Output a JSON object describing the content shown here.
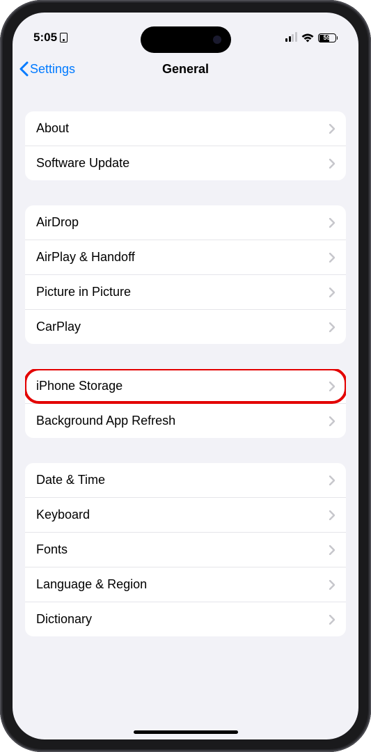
{
  "status": {
    "time": "5:05",
    "battery": "59"
  },
  "nav": {
    "back": "Settings",
    "title": "General"
  },
  "groups": [
    {
      "items": [
        {
          "label": "About"
        },
        {
          "label": "Software Update"
        }
      ]
    },
    {
      "items": [
        {
          "label": "AirDrop"
        },
        {
          "label": "AirPlay & Handoff"
        },
        {
          "label": "Picture in Picture"
        },
        {
          "label": "CarPlay"
        }
      ]
    },
    {
      "items": [
        {
          "label": "iPhone Storage",
          "highlighted": true
        },
        {
          "label": "Background App Refresh"
        }
      ]
    },
    {
      "items": [
        {
          "label": "Date & Time"
        },
        {
          "label": "Keyboard"
        },
        {
          "label": "Fonts"
        },
        {
          "label": "Language & Region"
        },
        {
          "label": "Dictionary"
        }
      ]
    }
  ]
}
